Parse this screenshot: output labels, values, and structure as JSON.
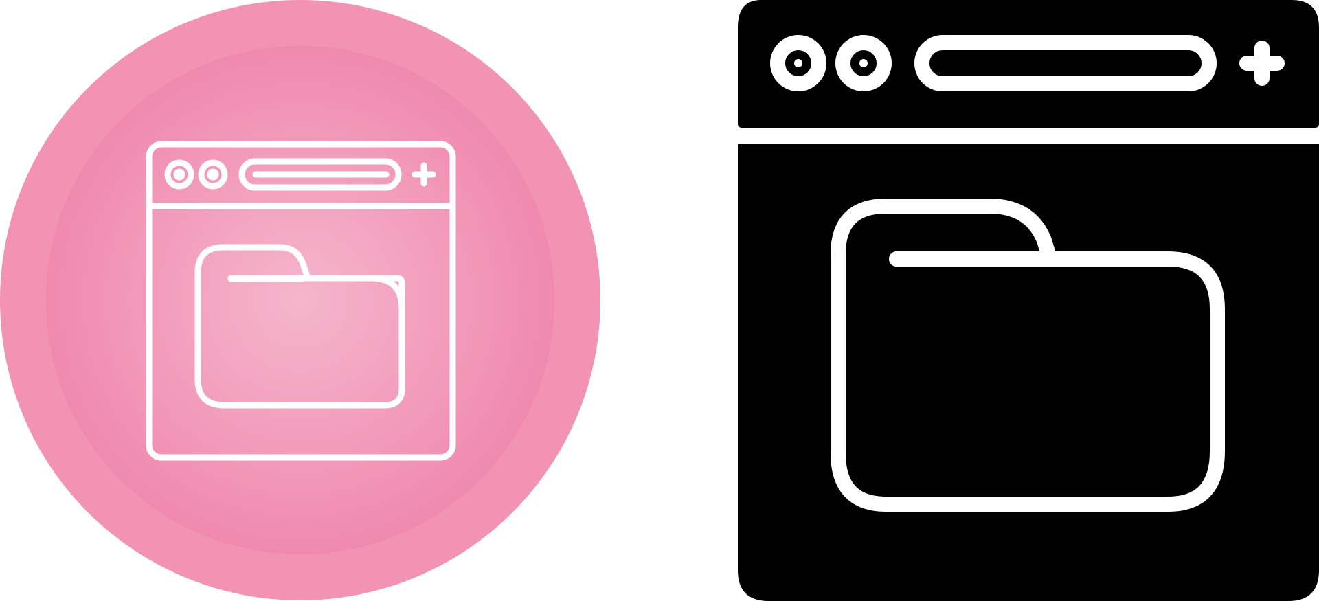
{
  "icons": [
    {
      "name": "browser-folder-icon-pink",
      "style": "line-icon-on-circle",
      "background_outer_color": "#F290B1",
      "background_inner_color": "#F4A9C4",
      "background_center_color": "#F5B6CC",
      "line_color": "#FFFFFF"
    },
    {
      "name": "browser-folder-icon-glyph",
      "style": "solid-glyph",
      "fill_color": "#000000",
      "line_color": "#FFFFFF"
    }
  ],
  "page_background": "#FFFFFF"
}
